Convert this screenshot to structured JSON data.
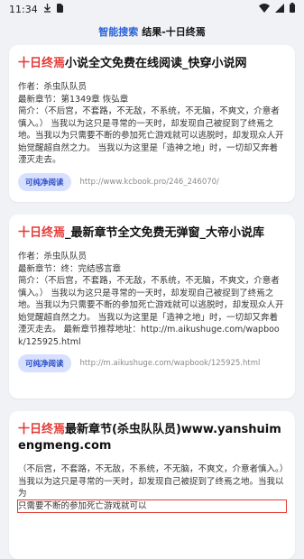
{
  "status": {
    "time": "11:34"
  },
  "header": {
    "brand": "智能搜索",
    "rest": "结果-十日终焉"
  },
  "results": [
    {
      "title_hl": "十日终焉",
      "title_rest": "小说全文免费在线阅读_快穿小说网",
      "author": "作者：杀虫队队员",
      "latest": "最新章节：第1349章 恢弘章",
      "intro": "简介：（不后宫，不套路，不无敌，不系统，不无脑，不爽文，介意者慎入。） 当我以为这只是寻常的一天时，却发现自己被捉到了终焉之地。当我以为只需要不断的参加死亡游戏就可以逃脱时，却发现众人开始觉醒超自然之力。 当我以为这里是「造神之地」时，一切却又奔着湮灭走去。",
      "pill": "可纯净阅读",
      "url": "http://www.kcbook.pro/246_246070/"
    },
    {
      "title_hl": "十日终焉",
      "title_rest": "_最新章节全文免费无弹窗_大帝小说库",
      "author": "作者：杀虫队队员",
      "latest": "最新章节：终：完结感言章",
      "intro": "简介：（不后宫，不套路，不无敌，不系统，不无脑，不爽文，介意者慎入。） 当我以为这只是寻常的一天时，却发现自己被捉到了终焉之地。当我以为只需要不断的参加死亡游戏就可以逃脱时，却发现众人开始觉醒超自然之力。 当我以为这里是「造神之地」时，一切却又奔着湮灭走去。 最新章节推荐地址：http://m.aikushuge.com/wapbook/125925.html",
      "pill": "可纯净阅读",
      "url": "http://m.aikushuge.com/wapbook/125925.html"
    },
    {
      "title_hl": "十日终焉",
      "title_rest": "最新章节(杀虫队队员)www.yanshuimengmeng.com",
      "intro_a": "（不后宫，不套路，不无敌，不系统，不无脑，不爽文，介意者慎入。）当我以为这只是寻常的一天时，却发现自己被捉到了终焉之地。当我以为",
      "intro_b": "只需要不断的参加死亡游戏就可以"
    }
  ]
}
